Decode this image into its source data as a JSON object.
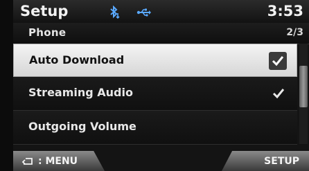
{
  "statusbar": {
    "title": "Setup",
    "time": "3:53",
    "icons": [
      "bluetooth-download-icon",
      "usb-icon"
    ]
  },
  "section": {
    "title": "Phone",
    "page": "2/3"
  },
  "items": [
    {
      "label": "Auto Download",
      "checked": true,
      "selected": true
    },
    {
      "label": "Streaming Audio",
      "checked": true,
      "selected": false
    },
    {
      "label": "Outgoing Volume",
      "checked": false,
      "selected": false
    }
  ],
  "softkeys": {
    "menu_label": ": MENU",
    "setup_label": "SETUP"
  },
  "colors": {
    "accent_blue": "#5aa9ff",
    "selected_bg": "#e6e6e6"
  }
}
